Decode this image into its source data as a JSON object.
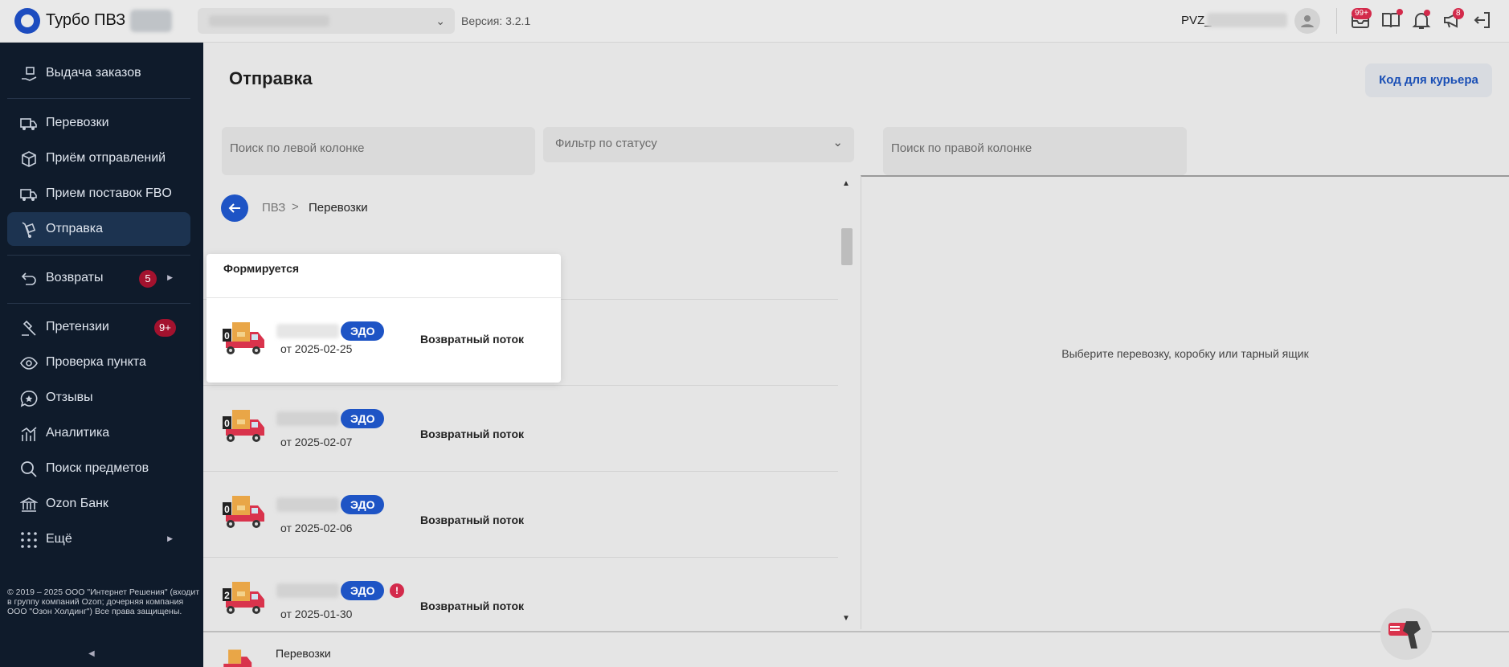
{
  "header": {
    "app_title": "Турбо ПВЗ",
    "version": "Версия: 3.2.1",
    "pvz_prefix": "PVZ_",
    "badge_messages": "99+",
    "badge_updates": "8"
  },
  "sidebar": {
    "items": [
      {
        "label": "Выдача заказов",
        "icon": "hand-box-icon"
      },
      {
        "label": "Перевозки",
        "icon": "truck-icon"
      },
      {
        "label": "Приём отправлений",
        "icon": "box-icon"
      },
      {
        "label": "Прием поставок FBO",
        "icon": "truck-fbo-icon"
      },
      {
        "label": "Отправка",
        "icon": "dolly-icon",
        "active": true
      },
      {
        "label": "Возвраты",
        "icon": "return-icon",
        "badge": "5"
      },
      {
        "label": "Претензии",
        "icon": "gavel-icon",
        "badge": "9+"
      },
      {
        "label": "Проверка пункта",
        "icon": "eye-icon"
      },
      {
        "label": "Отзывы",
        "icon": "chat-star-icon"
      },
      {
        "label": "Аналитика",
        "icon": "chart-icon"
      },
      {
        "label": "Поиск предметов",
        "icon": "search-icon"
      },
      {
        "label": "Ozon Банк",
        "icon": "bank-icon"
      },
      {
        "label": "Ещё",
        "icon": "grid-icon"
      }
    ],
    "copyright": "© 2019 – 2025 ООО \"Интернет Решения\" (входит в группу компаний Ozon; дочерняя компания ООО \"Озон Холдинг\") Все права защищены."
  },
  "main": {
    "title": "Отправка",
    "courier_button": "Код для курьера",
    "search_left_placeholder": "Поиск по левой колонке",
    "status_filter_placeholder": "Фильтр по статусу",
    "search_right_placeholder": "Поиск по правой колонке",
    "breadcrumb": {
      "root": "ПВЗ",
      "separator": ">",
      "current": "Перевозки"
    },
    "popup": {
      "title": "Формируется",
      "count": "0",
      "badge": "ЭДО",
      "date": "от 2025-02-25",
      "flow": "Возвратный поток"
    },
    "rows": [
      {
        "count": "0",
        "badge": "ЭДО",
        "date": "от 2025-02-07",
        "flow": "Возвратный поток",
        "warning": ""
      },
      {
        "count": "0",
        "badge": "ЭДО",
        "date": "от 2025-02-06",
        "flow": "Возвратный поток",
        "warning": ""
      },
      {
        "count": "2",
        "badge": "ЭДО",
        "date": "от 2025-01-30",
        "flow": "Возвратный поток",
        "warning": "!"
      }
    ],
    "right_hint": "Выберите перевозку, коробку или тарный ящик",
    "bottom_label": "Перевозки"
  },
  "colors": {
    "accent": "#1e54c5",
    "sidebar_bg": "#0f1b2b",
    "badge_red": "#a3122e"
  }
}
